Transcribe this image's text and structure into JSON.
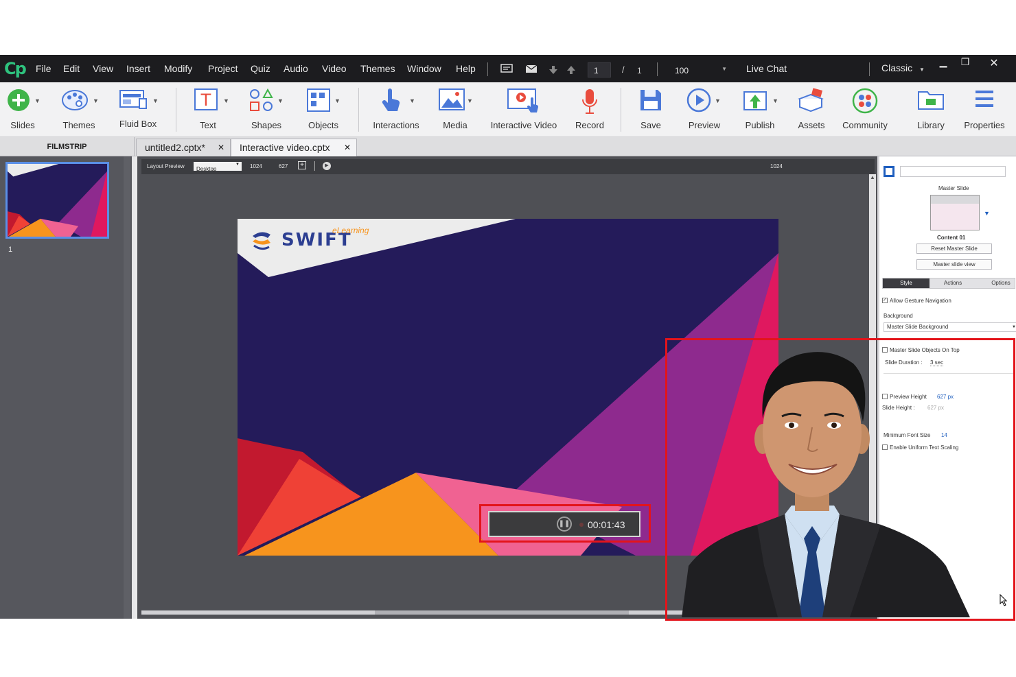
{
  "menubar": {
    "items": [
      "File",
      "Edit",
      "View",
      "Insert",
      "Modify",
      "Project",
      "Quiz",
      "Audio",
      "Video",
      "Themes",
      "Window",
      "Help"
    ],
    "slide_current": "1",
    "slide_separator": "/",
    "slide_total": "1",
    "zoom": "100",
    "live_chat": "Live Chat",
    "workspace": "Classic",
    "icons": [
      "caption-icon",
      "mail-icon",
      "arrow-down-icon",
      "arrow-up-icon"
    ]
  },
  "toolbar": {
    "buttons": [
      "Slides",
      "Themes",
      "Fluid Box",
      "Text",
      "Shapes",
      "Objects",
      "Interactions",
      "Media",
      "Interactive Video",
      "Record",
      "Save",
      "Preview",
      "Publish",
      "Assets",
      "Community",
      "Library",
      "Properties"
    ]
  },
  "tabs": {
    "filmstrip": "FILMSTRIP",
    "docs": [
      {
        "label": "untitled2.cptx*"
      },
      {
        "label": "Interactive video.cptx"
      }
    ]
  },
  "filmstrip": {
    "slide_number": "1"
  },
  "stage": {
    "layout_preview": "Layout Preview",
    "device": "Desktop",
    "width": "1024",
    "height": "627",
    "ruler_value": "1024"
  },
  "slide": {
    "logo_text": "SWIFT",
    "logo_tagline": "eLearning",
    "timer": "00:01:43"
  },
  "properties": {
    "master_slide": "Master Slide",
    "master_name": "Content 01",
    "reset_button": "Reset Master Slide",
    "view_button": "Master slide view",
    "tabs": [
      "Style",
      "Actions",
      "Options"
    ],
    "allow_gesture": "Allow Gesture Navigation",
    "background_label": "Background",
    "background_value": "Master Slide Background",
    "objects_on_top": "Master Slide Objects On Top",
    "slide_duration_label": "Slide Duration :",
    "slide_duration_value": "3 sec",
    "preview_height_label": "Preview Height",
    "preview_height_value": "627 px",
    "slide_height_label": "Slide Height :",
    "slide_height_value": "627 px",
    "min_font_label": "Minimum Font Size",
    "min_font_value": "14",
    "uniform_scaling": "Enable Uniform Text Scaling"
  },
  "colors": {
    "slide_navy": "#241b5a",
    "slide_pink": "#e0185f",
    "slide_purple": "#8e2a8e",
    "slide_orange": "#f7941d",
    "highlight_red": "#e3141b",
    "filmstrip_select": "#5a8fe6"
  }
}
